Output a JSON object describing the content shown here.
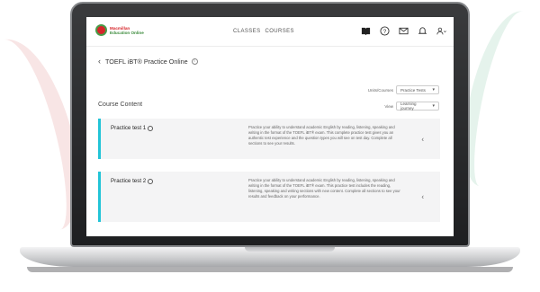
{
  "header": {
    "logo_line1": "Macmillan",
    "logo_line2": "Education Online",
    "nav": [
      "CLASSES",
      "COURSES"
    ]
  },
  "page": {
    "title": "TOEFL iBT® Practice Online",
    "section_title": "Course Content",
    "unit_label": "Units/Courses",
    "unit_value": "Practice Tests",
    "view_label": "View",
    "view_value": "Learning journey"
  },
  "cards": [
    {
      "name": "Practice test 1",
      "description": "Practice your ability to understand academic English by reading, listening, speaking and writing in the format of the TOEFL iBT® exam. This complete practice test gives you an authentic test experience and the question types you will see on test day. Complete all sections to see your results."
    },
    {
      "name": "Practice test 2",
      "description": "Practice your ability to understand academic English by reading, listening, speaking and writing in the format of the TOEFL iBT® exam. This practice test includes the reading, listening, speaking and writing sections with new content. Complete all sections to see your results and feedback on your performance."
    }
  ]
}
